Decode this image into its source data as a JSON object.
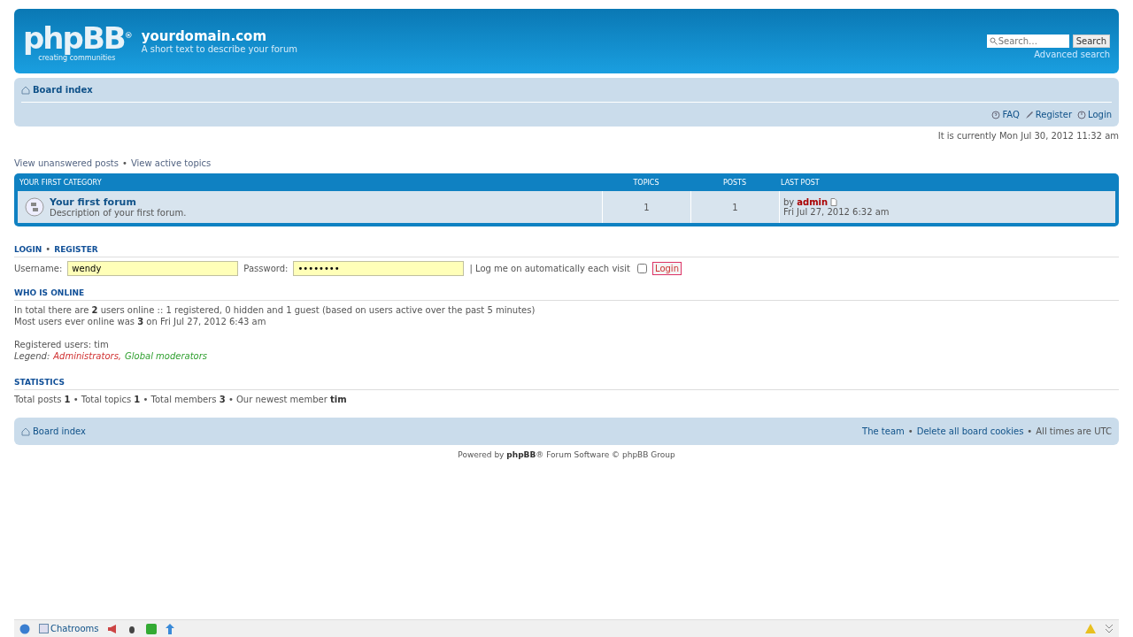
{
  "header": {
    "logo": {
      "name": "phpBB",
      "mark": "®",
      "tagline": "creating communities"
    },
    "site_title": "yourdomain.com",
    "site_description": "A short text to describe your forum",
    "search": {
      "placeholder": "Search…",
      "button": "Search"
    },
    "advanced_search": "Advanced search"
  },
  "navbar": {
    "breadcrumb": "Board index",
    "links": [
      {
        "kind": "faq",
        "label": "FAQ"
      },
      {
        "kind": "register",
        "label": "Register"
      },
      {
        "kind": "login",
        "label": "Login"
      }
    ]
  },
  "current_time": "It is currently Mon Jul 30, 2012 11:32 am",
  "quick_links": [
    "View unanswered posts",
    "View active topics"
  ],
  "forum_table": {
    "columns": [
      "YOUR FIRST CATEGORY",
      "TOPICS",
      "POSTS",
      "LAST POST"
    ],
    "rows": [
      {
        "title": "Your first forum",
        "description": "Description of your first forum.",
        "topics": "1",
        "posts": "1",
        "last_post_by": "by",
        "last_post_author": "admin",
        "last_post_time": "Fri Jul 27, 2012 6:32 am"
      }
    ]
  },
  "login": {
    "heading_login": "LOGIN",
    "heading_register": "REGISTER",
    "username_label": "Username:",
    "username": "wendy",
    "password_label": "Password:",
    "password": "••••••••",
    "remember_label": "| Log me on automatically each visit",
    "remember_checked": false,
    "button": "Login"
  },
  "who_is_online": {
    "heading": "WHO IS ONLINE",
    "lines": [
      "In total there are **2** users online :: 1 registered, 0 hidden and 1 guest (based on users active over the past 5 minutes)",
      "Most users ever online was **3** on Fri Jul 27, 2012 6:43 am"
    ],
    "registered": "Registered users: tim",
    "legend_label": "Legend:",
    "legend": [
      {
        "label": "Administrators,",
        "color": "#d03030"
      },
      {
        "label": "Global moderators",
        "color": "#30a030"
      }
    ]
  },
  "statistics": {
    "heading": "STATISTICS",
    "text": "Total posts **1** • Total topics **1** • Total members **3** • Our newest member **tim**"
  },
  "footer_nav": {
    "breadcrumb": "Board index",
    "links": [
      "The team",
      "Delete all board cookies"
    ],
    "timezone": "All times are UTC"
  },
  "powered_by": "Powered by **phpBB**® Forum Software © phpBB Group",
  "taskbar": {
    "chatrooms": "Chatrooms"
  },
  "separator": "•"
}
